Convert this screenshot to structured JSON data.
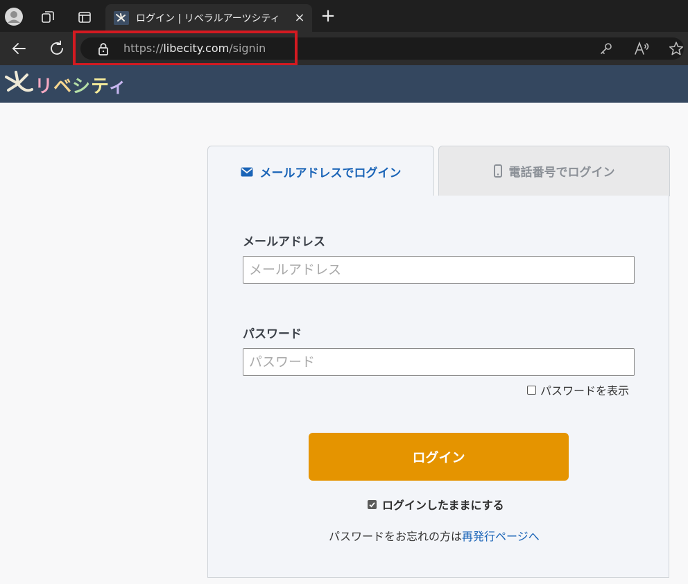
{
  "browser": {
    "tab_title": "ログイン | リベラルアーツシティ",
    "tab_close": "×",
    "new_tab": "+",
    "url_scheme": "https://",
    "url_host": "libecity.com",
    "url_path": "/signin"
  },
  "site": {
    "logo_text": "リベシティ"
  },
  "tabs": {
    "email_label": "メールアドレスでログイン",
    "phone_label": "電話番号でログイン"
  },
  "form": {
    "email_label": "メールアドレス",
    "email_placeholder": "メールアドレス",
    "email_value": "",
    "password_label": "パスワード",
    "password_placeholder": "パスワード",
    "password_value": "",
    "show_password_label": "パスワードを表示",
    "show_password_checked": false,
    "login_button": "ログイン",
    "remember_label": "ログインしたままにする",
    "remember_checked": true,
    "forgot_text": "パスワードをお忘れの方は",
    "forgot_link": "再発行ページへ"
  },
  "colors": {
    "accent_blue": "#1a64b7",
    "login_orange": "#e59400",
    "header_navy": "#34475f",
    "highlight_red": "#d31a21"
  }
}
